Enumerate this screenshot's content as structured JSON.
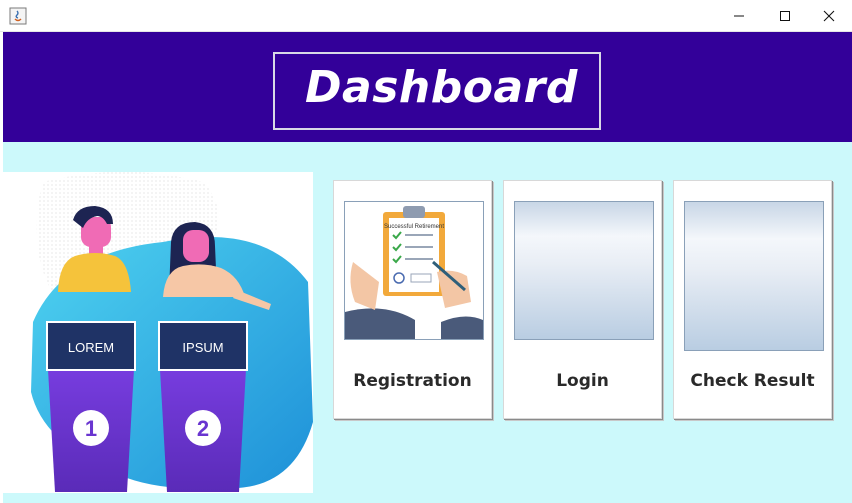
{
  "window": {
    "controls": [
      "minimize-icon",
      "maximize-icon",
      "close-icon"
    ]
  },
  "header": {
    "title": "Dashboard",
    "background_color": "#330099"
  },
  "illustration": {
    "podium_1_label": "LOREM",
    "podium_2_label": "IPSUM",
    "podium_1_number": "1",
    "podium_2_number": "2"
  },
  "cards": [
    {
      "label": "Registration",
      "image_icon": "clipboard-checklist-icon",
      "image_text": "Successful Retirement"
    },
    {
      "label": "Login",
      "image_icon": "blank-image"
    },
    {
      "label": "Check Result",
      "image_icon": "blank-image"
    }
  ],
  "colors": {
    "body_background": "#ccf9fb",
    "accent": "#330099"
  }
}
